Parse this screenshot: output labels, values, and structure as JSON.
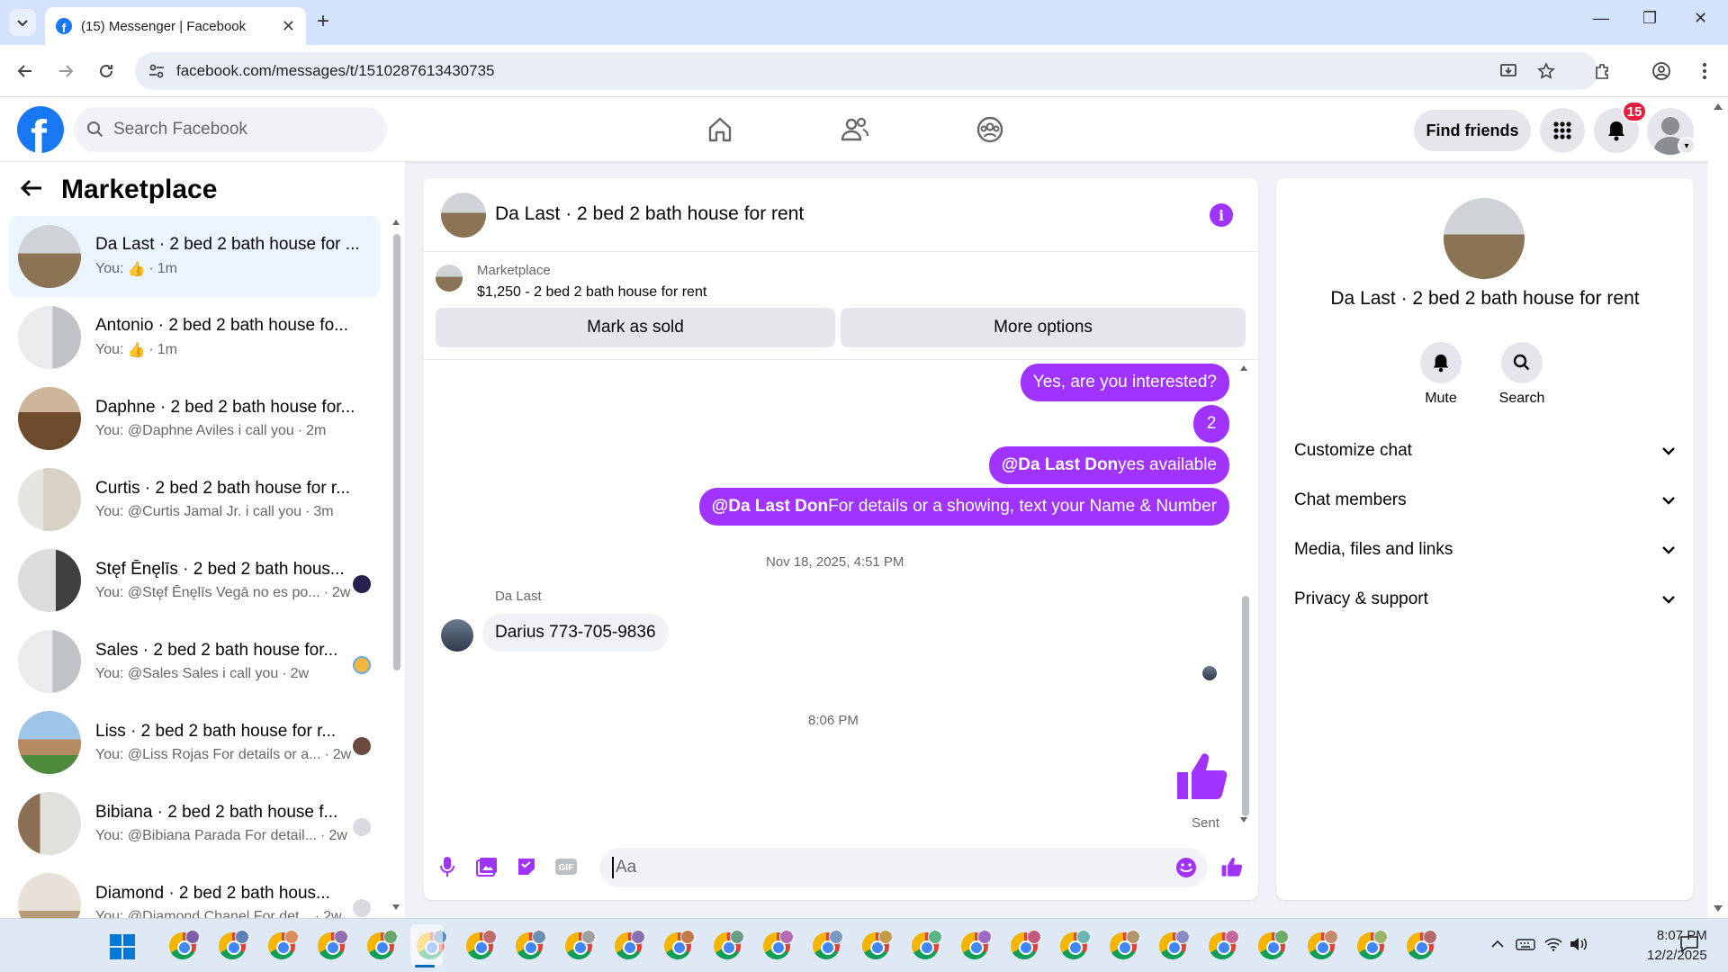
{
  "browser": {
    "tab_title": "(15) Messenger | Facebook",
    "url": "facebook.com/messages/t/1510287613430735"
  },
  "fbnav": {
    "search_placeholder": "Search Facebook",
    "find_friends": "Find friends",
    "notifications_count": "15"
  },
  "sidebar": {
    "title": "Marketplace",
    "conversations": [
      {
        "name": "Da Last · 2 bed 2 bath house for ...",
        "preview": "You:",
        "time": "1m",
        "liked": true,
        "active": true
      },
      {
        "name": "Antonio · 2 bed 2 bath house fo...",
        "preview": "You:",
        "time": "1m",
        "liked": true,
        "active": false
      },
      {
        "name": "Daphne · 2 bed 2 bath house for...",
        "preview": "You: @Daphne Aviles i call you",
        "time": "2m",
        "active": false
      },
      {
        "name": "Curtis · 2 bed 2 bath house for r...",
        "preview": "You: @Curtis Jamal Jr. i call you",
        "time": "3m",
        "active": false
      },
      {
        "name": "Stęf Ēnęlīs · 2 bed 2 bath hous...",
        "preview": "You: @Stęf Ēnęlīs Vegā no es po...",
        "time": "2w",
        "active": false
      },
      {
        "name": "Sales · 2 bed 2 bath house for...",
        "preview": "You: @Sales Sales i call you",
        "time": "2w",
        "active": false
      },
      {
        "name": "Liss · 2 bed 2 bath house for r...",
        "preview": "You: @Liss Rojas For details or a...",
        "time": "2w",
        "active": false
      },
      {
        "name": "Bibiana · 2 bed 2 bath house f...",
        "preview": "You: @Bibiana Parada For detail...",
        "time": "2w",
        "active": false
      },
      {
        "name": "Diamond · 2 bed 2 bath hous...",
        "preview": "You: @Diamond Chanel For det...",
        "time": "2w",
        "active": false
      }
    ]
  },
  "chat": {
    "title": "Da Last · 2 bed 2 bath house for rent",
    "listing_category": "Marketplace",
    "listing_title": "$1,250 - 2 bed 2 bath house for rent",
    "mark_sold": "Mark as sold",
    "more_options": "More options",
    "outgoing": {
      "m1": "Yes, are you interested?",
      "m2": "2",
      "m3_mention": "@Da Last Don",
      "m3_text": " yes available",
      "m4_mention": "@Da Last Don",
      "m4_text": " For details or a showing, text your Name & Number"
    },
    "timestamp1": "Nov 18, 2025, 4:51 PM",
    "incoming_sender": "Da Last",
    "incoming_message": "Darius 773-705-9836",
    "timestamp2": "8:06 PM",
    "sent_label": "Sent",
    "composer_placeholder": "Aa"
  },
  "infopanel": {
    "title": "Da Last · 2 bed 2 bath house for rent",
    "mute": "Mute",
    "search": "Search",
    "sections": [
      "Customize chat",
      "Chat members",
      "Media, files and links",
      "Privacy & support"
    ]
  },
  "taskbar": {
    "time": "8:07 PM",
    "date": "12/2/2025"
  },
  "colors": {
    "accent": "#a033ff",
    "facebook_blue": "#1877f2",
    "notification_red": "#e41e3f"
  }
}
